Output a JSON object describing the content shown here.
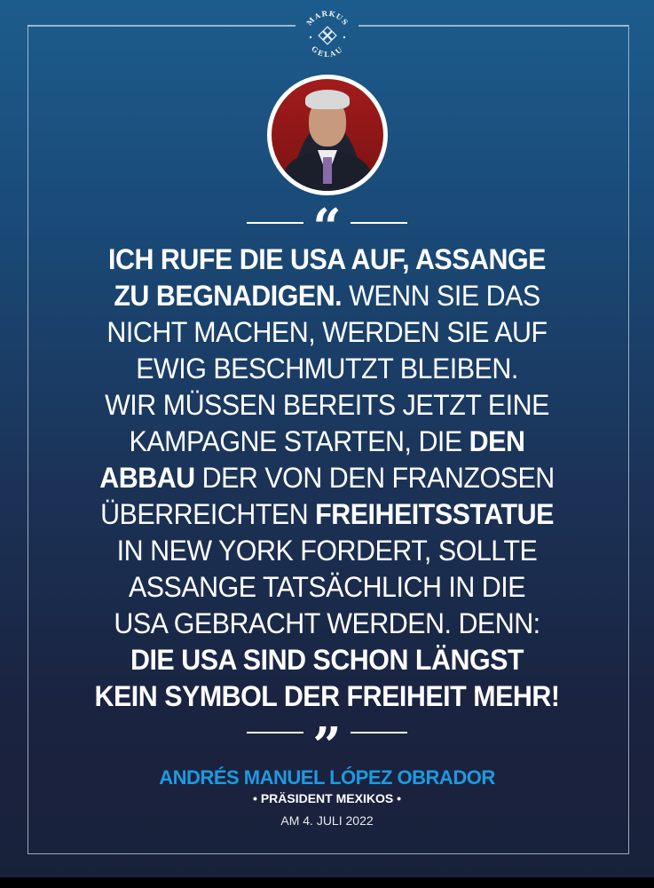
{
  "logo": {
    "text_top": "MARKUS",
    "text_bottom": "GELAU"
  },
  "quote": {
    "open_mark": "“",
    "close_mark": "”",
    "lines": [
      [
        {
          "t": "ICH RUFE DIE USA AUF, ASSANGE",
          "b": true
        }
      ],
      [
        {
          "t": "ZU BEGNADIGEN.",
          "b": true
        },
        {
          "t": " WENN SIE DAS",
          "b": false
        }
      ],
      [
        {
          "t": "NICHT MACHEN, WERDEN SIE AUF",
          "b": false
        }
      ],
      [
        {
          "t": "EWIG BESCHMUTZT BLEIBEN.",
          "b": false
        }
      ],
      [
        {
          "t": "WIR MÜSSEN BEREITS JETZT EINE",
          "b": false
        }
      ],
      [
        {
          "t": "KAMPAGNE STARTEN, DIE ",
          "b": false
        },
        {
          "t": "DEN",
          "b": true
        }
      ],
      [
        {
          "t": "ABBAU",
          "b": true
        },
        {
          "t": " DER VON DEN FRANZOSEN",
          "b": false
        }
      ],
      [
        {
          "t": "ÜBERREICHTEN ",
          "b": false
        },
        {
          "t": "FREIHEITSSTATUE",
          "b": true
        }
      ],
      [
        {
          "t": "IN NEW YORK FORDERT, SOLLTE",
          "b": false
        }
      ],
      [
        {
          "t": "ASSANGE TATSÄCHLICH IN DIE",
          "b": false
        }
      ],
      [
        {
          "t": "USA GEBRACHT WERDEN. DENN:",
          "b": false
        }
      ],
      [
        {
          "t": "DIE USA SIND SCHON LÄNGST",
          "b": true
        }
      ],
      [
        {
          "t": "KEIN SYMBOL DER FREIHEIT MEHR!",
          "b": true
        }
      ]
    ]
  },
  "attribution": {
    "name": "ANDRÉS MANUEL LÓPEZ OBRADOR",
    "title": "• PRÄSIDENT MEXIKOS •",
    "date": "AM 4. JULI 2022"
  },
  "colors": {
    "accent": "#1e9ae0",
    "bg_top": "#1c5c8c",
    "bg_bottom": "#19213a"
  }
}
